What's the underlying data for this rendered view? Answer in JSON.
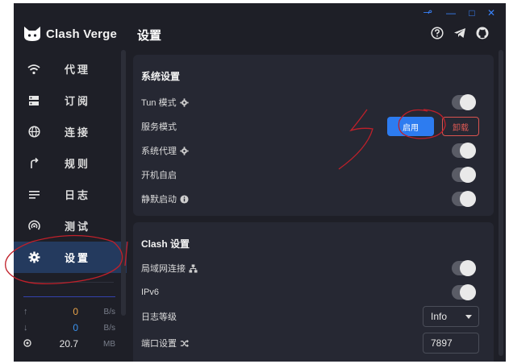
{
  "app": {
    "name": "Clash Verge"
  },
  "window_controls": {
    "pin": "ㆪ",
    "minimize": "—",
    "maximize": "□",
    "close": "✕"
  },
  "sidebar": {
    "items": [
      {
        "label": "代理",
        "icon": "wifi-icon"
      },
      {
        "label": "订阅",
        "icon": "dns-icon"
      },
      {
        "label": "连接",
        "icon": "globe-icon"
      },
      {
        "label": "规则",
        "icon": "fork-icon"
      },
      {
        "label": "日志",
        "icon": "list-icon"
      },
      {
        "label": "测试",
        "icon": "radar-icon"
      },
      {
        "label": "设置",
        "icon": "gear-icon",
        "active": true
      }
    ],
    "traffic": {
      "upload": {
        "arrow": "↑",
        "value": "0",
        "unit": "B/s"
      },
      "download": {
        "arrow": "↓",
        "value": "0",
        "unit": "B/s"
      },
      "memory": {
        "value": "20.7",
        "unit": "MB"
      }
    }
  },
  "header": {
    "title": "设置"
  },
  "system_settings": {
    "title": "系统设置",
    "tun_mode": "Tun 模式",
    "service_mode": "服务模式",
    "install_button": "启用",
    "uninstall_button": "卸载",
    "system_proxy": "系统代理",
    "auto_launch": "开机自启",
    "silent_start": "静默启动"
  },
  "clash_settings": {
    "title": "Clash 设置",
    "lan": "局域网连接",
    "ipv6": "IPv6",
    "log_level": "日志等级",
    "log_level_value": "Info",
    "port": "端口设置",
    "port_value": "7897"
  },
  "colors": {
    "accent": "#2d7cf0",
    "danger": "#e05a55",
    "upload": "#e8a34a",
    "download": "#3b93f0"
  }
}
